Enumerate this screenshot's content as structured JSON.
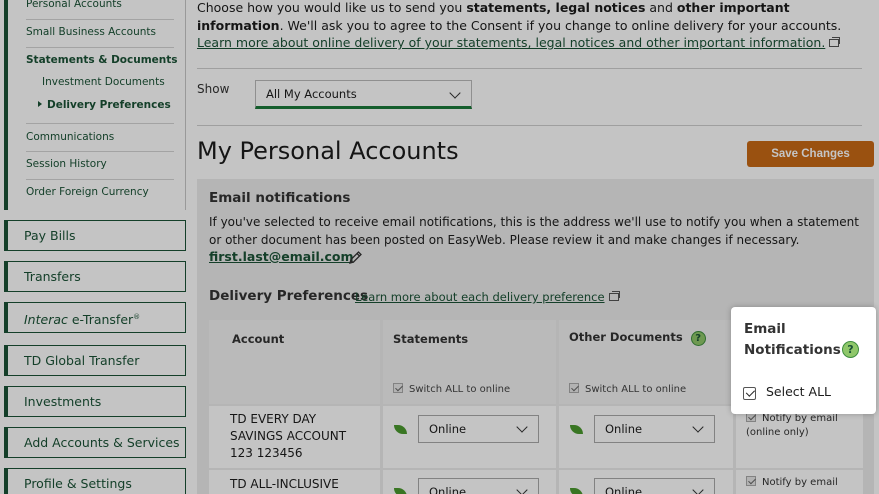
{
  "sidebar": {
    "subnav": [
      "Personal Accounts",
      "Small Business Accounts",
      "Statements & Documents",
      "Investment Documents",
      "Delivery Preferences",
      "Communications",
      "Session History",
      "Order Foreign Currency"
    ],
    "main_nav": {
      "pay_bills": "Pay Bills",
      "transfers": "Transfers",
      "interac_italic": "Interac",
      "interac_rest": " e-Transfer",
      "interac_reg": "®",
      "global_transfer": "TD Global Transfer",
      "investments": "Investments",
      "add_accounts": "Add Accounts & Services",
      "profile": "Profile & Settings"
    }
  },
  "intro": {
    "text_1": "Choose how you would like us to send you ",
    "bold_1": "statements, legal notices",
    "text_2": " and ",
    "bold_2": "other important information",
    "text_3": ". We'll ask you to agree to the Consent if you change to online delivery for your accounts. ",
    "link": "Learn more about online delivery of your statements, legal notices and other important information."
  },
  "filter": {
    "show_label": "Show",
    "selected": "All My Accounts"
  },
  "page_title": "My Personal Accounts",
  "save_button": "Save Changes",
  "email_section": {
    "heading": "Email notifications",
    "text": "If you've selected to receive email notifications, this is the address we'll use to notify you when a statement or other document has been posted on EasyWeb. Please review it and make changes if necessary.",
    "address": "first.last@email.com"
  },
  "delivery": {
    "heading": "Delivery Preferences",
    "link": "Learn more about each delivery preference"
  },
  "table": {
    "headers": {
      "account": "Account",
      "statements": "Statements",
      "other_documents": "Other Documents",
      "help": "?"
    },
    "switch_all": "Switch ALL to online",
    "rows": [
      {
        "line1": "TD EVERY DAY",
        "line2": "SAVINGS ACCOUNT",
        "line3": "123 123456",
        "statements": "Online",
        "other_documents": "Online",
        "notify": "Notify by email (online only)"
      },
      {
        "line1": "TD ALL-INCLUSIVE",
        "statements": "Online",
        "other_documents": "Online",
        "notify": "Notify by email"
      }
    ]
  },
  "popup": {
    "title_1": "Email",
    "title_2": "Notifications",
    "help": "?",
    "select_all": "Select ALL"
  },
  "colors": {
    "brand_green": "#1a5336",
    "accent_orange": "#c96a16",
    "leaf_green": "#4b9a2e"
  }
}
